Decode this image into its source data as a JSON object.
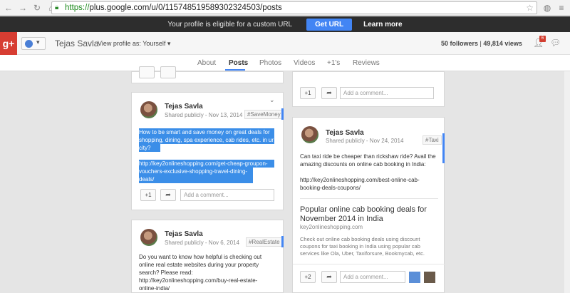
{
  "browser": {
    "url_scheme": "https://",
    "url_rest": "plus.google.com/u/0/115748519589302324503/posts"
  },
  "notification": {
    "text": "Your profile is eligible for a custom URL",
    "get_url_label": "Get URL",
    "learn_more_label": "Learn more"
  },
  "header": {
    "logo": "g+",
    "profile_name": "Tejas Savla",
    "view_as": "View profile as: Yourself ▾",
    "followers": "50 followers",
    "views": "49,814 views",
    "notif_count": "6"
  },
  "tabs": [
    "About",
    "Posts",
    "Photos",
    "Videos",
    "+1's",
    "Reviews"
  ],
  "posts": [
    {
      "author": "Tejas Savla",
      "meta": "Shared publicly  -  Nov 13, 2014",
      "hashtag": "#SaveMoney",
      "text_lines": [
        "How to be smart and save money on great deals for",
        "shopping, dining, spa experience, cab rides, etc. in ur",
        "city?",
        "",
        "http://key2onlineshopping.com/get-cheap-groupon-",
        "vouchers-exclusive-shopping-travel-dining-deals/"
      ],
      "plus_count": "+1",
      "comment_placeholder": "Add a comment..."
    },
    {
      "author": "Tejas Savla",
      "meta": "Shared publicly  -  Nov 6, 2014",
      "hashtag": "#RealEstate",
      "text_lines": [
        "Do you want to know how helpful is checking out",
        "online real estate websites during your property",
        "search? Please read:",
        "http://key2onlineshopping.com/buy-real-estate-",
        "online-india/"
      ]
    },
    {
      "author": "Tejas Savla",
      "meta": "Shared publicly  -  Nov 24, 2014",
      "hashtag": "#Taxi",
      "text_lines": [
        "Can taxi ride be cheaper than rickshaw ride? Avail  the",
        "amazing discounts on online cab booking in India:",
        "",
        "http://key2onlineshopping.com/best-online-cab-",
        "booking-deals-coupons/"
      ],
      "link_title_lines": [
        "Popular online cab booking deals for",
        "November 2014 in India"
      ],
      "link_domain": "key2onlineshopping.com",
      "link_desc_lines": [
        "Check out online cab booking deals using discount",
        "coupons for taxi booking in India using popular cab",
        "services like Ola, Uber, Taxiforsure, Bookmycab, etc."
      ],
      "plus_count": "+2",
      "comment_placeholder": "Add a comment..."
    }
  ],
  "top_right_card": {
    "plus_count": "+1",
    "comment_placeholder": "Add a comment..."
  }
}
